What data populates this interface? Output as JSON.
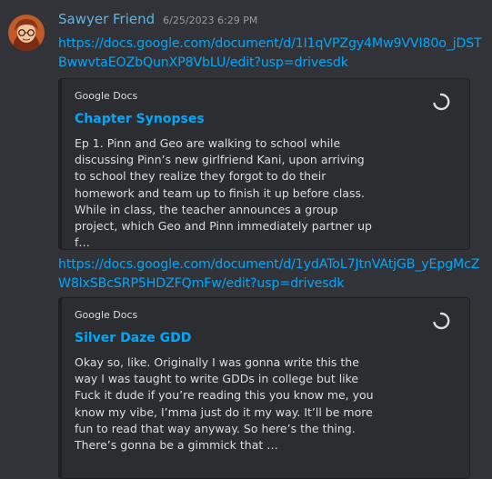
{
  "message": {
    "username": "Sawyer Friend",
    "timestamp": "6/25/2023 6:29 PM",
    "link1": "https://docs.google.com/document/d/1I1qVPZgy4Mw9VVI80o_jDSTBwwvtaEOZbQunXP8VbLU/edit?usp=drivesdk",
    "embed1": {
      "provider": "Google Docs",
      "title": "Chapter Synopses",
      "description": "Ep 1. Pinn and Geo are walking to school while discussing Pinn’s new girlfriend Kani, upon arriving to school they realize they forgot to do their homework and team up to finish it up before class. While in class, the teacher announces a group project, which Geo and Pinn immediately partner up f…"
    },
    "link2": "https://docs.google.com/document/d/1ydAToL7JtnVAtjGB_yEpgMcZW8lxSBcSRP5HDZFQmFw/edit?usp=drivesdk",
    "embed2": {
      "provider": "Google Docs",
      "title": "Silver Daze GDD",
      "description": "Okay so, like. Originally I was gonna write this the way I was taught to write GDDs in college but like Fuck it dude if you’re reading this you know me, you know my vibe, I’mma just do it my way. It’ll be more fun to read that way anyway. So here’s the thing. There’s gonna be a gimmick that …"
    }
  },
  "colors": {
    "background": "#313338",
    "embed_background": "#2b2d31",
    "link": "#00a8fc",
    "username": "#5fb4e3",
    "timestamp": "#949ba4"
  },
  "icons": [
    "avatar",
    "loading-spinner-icon"
  ]
}
